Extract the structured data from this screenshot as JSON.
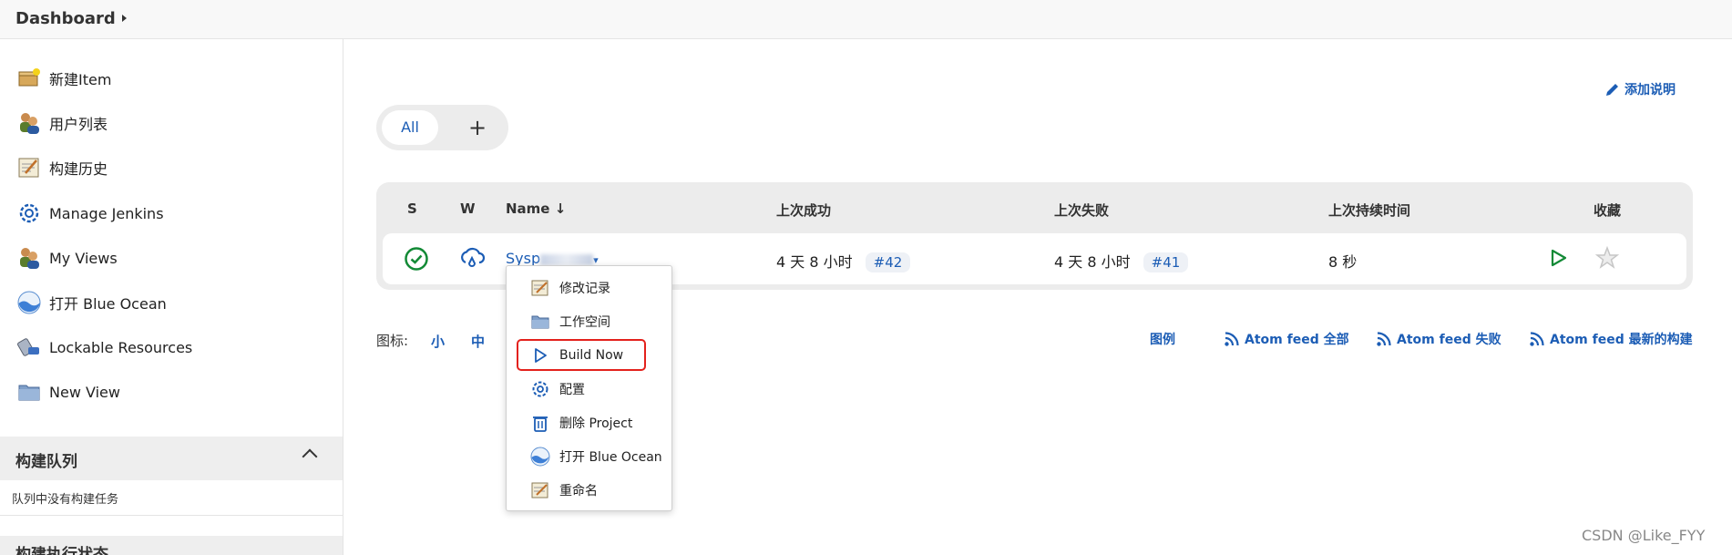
{
  "breadcrumb": {
    "label": "Dashboard"
  },
  "sidebar": {
    "items": [
      {
        "label": "新建Item",
        "icon": "new-item-icon"
      },
      {
        "label": "用户列表",
        "icon": "users-icon"
      },
      {
        "label": "构建历史",
        "icon": "notepad-icon"
      },
      {
        "label": "Manage Jenkins",
        "icon": "gear-icon"
      },
      {
        "label": "My Views",
        "icon": "users-icon"
      },
      {
        "label": "打开 Blue Ocean",
        "icon": "blue-ocean-icon"
      },
      {
        "label": "Lockable Resources",
        "icon": "lock-resource-icon"
      },
      {
        "label": "New View",
        "icon": "folder-icon"
      }
    ],
    "queue": {
      "title": "构建队列",
      "empty": "队列中没有构建任务"
    },
    "executors": {
      "title": "构建执行状态"
    }
  },
  "add_description": "添加说明",
  "tabs": {
    "all": "All",
    "add": "+"
  },
  "table": {
    "headers": {
      "s": "S",
      "w": "W",
      "name": "Name ↓",
      "last_success": "上次成功",
      "last_failure": "上次失败",
      "last_duration": "上次持续时间",
      "favorite": "收藏"
    },
    "rows": [
      {
        "name": "Sysp",
        "last_success": "4 天 8 小时",
        "last_success_build": "#42",
        "last_failure": "4 天 8 小时",
        "last_failure_build": "#41",
        "duration": "8 秒"
      }
    ]
  },
  "legend": {
    "label": "图标:",
    "small": "小",
    "medium": "中",
    "legend_link": "图例",
    "feed_all": "Atom feed 全部",
    "feed_failed": "Atom feed 失败",
    "feed_latest": "Atom feed 最新的构建"
  },
  "context_menu": {
    "items": [
      {
        "label": "修改记录",
        "icon": "notepad-icon"
      },
      {
        "label": "工作空间",
        "icon": "folder-icon"
      },
      {
        "label": "Build Now",
        "icon": "play-icon"
      },
      {
        "label": "配置",
        "icon": "gear-icon"
      },
      {
        "label": "删除 Project",
        "icon": "trash-icon"
      },
      {
        "label": "打开 Blue Ocean",
        "icon": "blue-ocean-icon"
      },
      {
        "label": "重命名",
        "icon": "notepad-icon"
      }
    ]
  },
  "watermark": "CSDN @Like_FYY",
  "colors": {
    "link": "#1c5db5",
    "success": "#138a36",
    "highlight": "#e3211c"
  }
}
